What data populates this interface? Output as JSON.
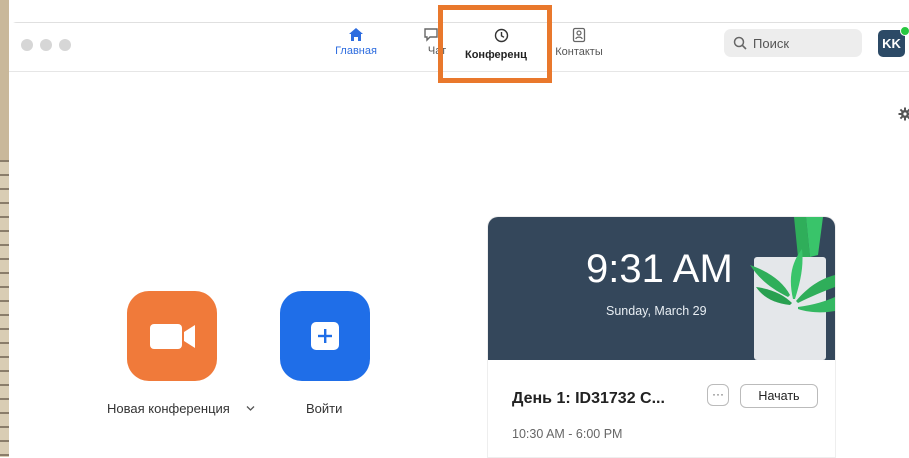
{
  "tabs": [
    {
      "label": "Главная",
      "icon": "home-icon",
      "active": true
    },
    {
      "label": "Чат",
      "icon": "chat-icon",
      "active": false
    },
    {
      "label": "Конференц",
      "icon": "clock-icon",
      "active": false
    },
    {
      "label": "Контакты",
      "icon": "contacts-icon",
      "active": false
    }
  ],
  "search": {
    "placeholder": "Поиск"
  },
  "avatar": {
    "initials": "KK"
  },
  "actions": {
    "new_meeting_label": "Новая конференция",
    "join_label": "Войти"
  },
  "card": {
    "time": "9:31 AM",
    "date": "Sunday, March 29",
    "meeting_title": "День 1: ID31732 С...",
    "more_label": "···",
    "start_label": "Начать",
    "meeting_time": "10:30 AM - 6:00 PM"
  },
  "colors": {
    "accent_blue": "#2d6cdf",
    "orange": "#f07a3a",
    "highlight": "#e9782c",
    "card_header": "#34475b",
    "presence": "#28c840"
  }
}
